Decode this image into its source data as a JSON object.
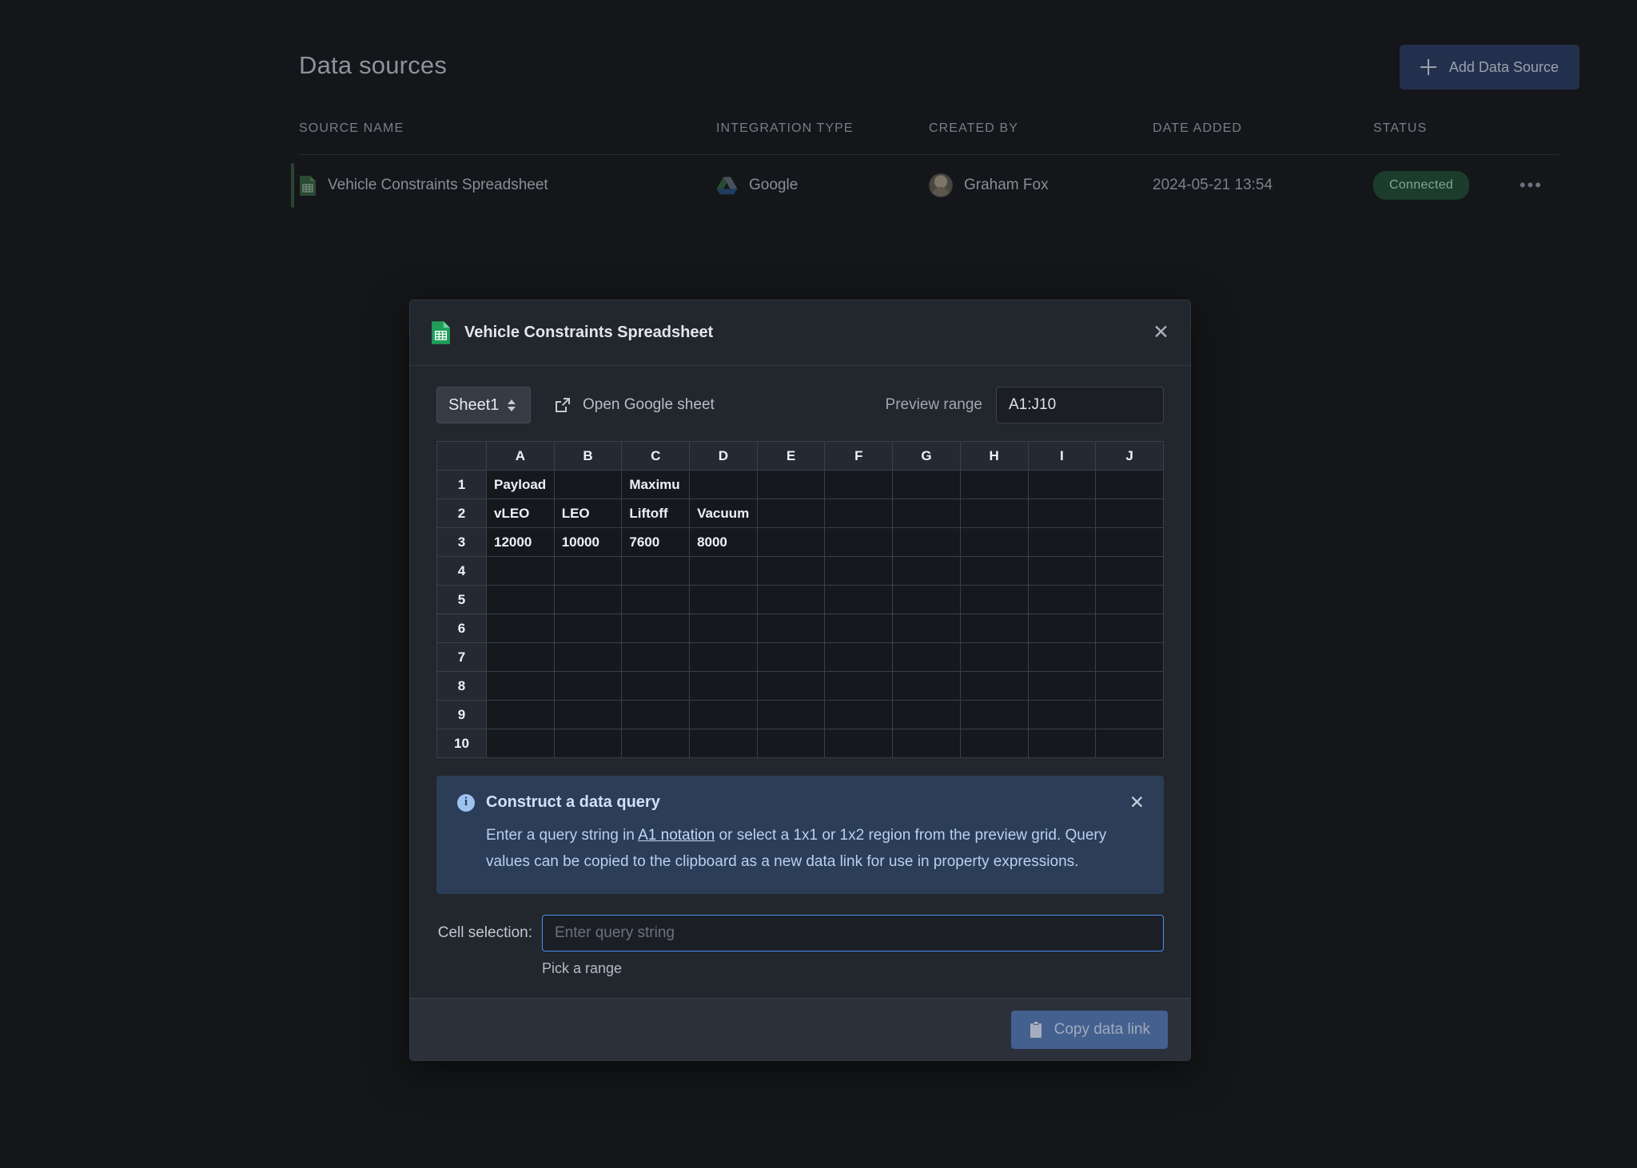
{
  "page": {
    "title": "Data sources",
    "add_button": {
      "label": "Add Data Source",
      "icon": "plus-icon"
    }
  },
  "table": {
    "columns": [
      "SOURCE NAME",
      "INTEGRATION TYPE",
      "CREATED BY",
      "DATE ADDED",
      "STATUS"
    ],
    "rows": [
      {
        "name": "Vehicle Constraints Spreadsheet",
        "name_icon": "google-sheets-file-icon",
        "integration_type": "Google",
        "integration_icon": "google-drive-icon",
        "created_by": "Graham Fox",
        "created_by_avatar": "user-avatar",
        "date_added": "2024-05-21 13:54",
        "status": "Connected",
        "status_color": "#1c3d2b",
        "overflow_menu": "•••"
      }
    ]
  },
  "modal": {
    "title": "Vehicle Constraints Spreadsheet",
    "title_icon": "google-sheets-file-icon",
    "close_label": "✕",
    "toolbar": {
      "sheet_select_value": "Sheet1",
      "open_sheet_label": "Open Google sheet",
      "open_sheet_icon": "external-link-icon",
      "preview_range_label": "Preview range",
      "preview_range_value": "A1:J10"
    },
    "grid": {
      "column_headers": [
        "A",
        "B",
        "C",
        "D",
        "E",
        "F",
        "G",
        "H",
        "I",
        "J"
      ],
      "row_numbers": [
        "1",
        "2",
        "3",
        "4",
        "5",
        "6",
        "7",
        "8",
        "9",
        "10"
      ],
      "cells": [
        [
          "Payload",
          "",
          "Maximu",
          "",
          "",
          "",
          "",
          "",
          "",
          ""
        ],
        [
          "vLEO",
          "LEO",
          "Liftoff",
          "Vacuum",
          "",
          "",
          "",
          "",
          "",
          ""
        ],
        [
          "12000",
          "10000",
          "7600",
          "8000",
          "",
          "",
          "",
          "",
          "",
          ""
        ],
        [
          "",
          "",
          "",
          "",
          "",
          "",
          "",
          "",
          "",
          ""
        ],
        [
          "",
          "",
          "",
          "",
          "",
          "",
          "",
          "",
          "",
          ""
        ],
        [
          "",
          "",
          "",
          "",
          "",
          "",
          "",
          "",
          "",
          ""
        ],
        [
          "",
          "",
          "",
          "",
          "",
          "",
          "",
          "",
          "",
          ""
        ],
        [
          "",
          "",
          "",
          "",
          "",
          "",
          "",
          "",
          "",
          ""
        ],
        [
          "",
          "",
          "",
          "",
          "",
          "",
          "",
          "",
          "",
          ""
        ],
        [
          "",
          "",
          "",
          "",
          "",
          "",
          "",
          "",
          "",
          ""
        ]
      ]
    },
    "info": {
      "icon": "info-icon",
      "title": "Construct a data query",
      "body_part1": "Enter a query string in ",
      "link_text": "A1 notation",
      "body_part2": " or select a 1x1 or 1x2 region from the preview grid. Query values can be copied to the clipboard as a new data link for use in property expressions.",
      "close_label": "✕",
      "background_color": "#2b3d57"
    },
    "cell_selection": {
      "label": "Cell selection:",
      "value": "",
      "placeholder": "Enter query string",
      "hint": "Pick a range",
      "focus_color": "#4c8ff0"
    },
    "footer": {
      "copy_label": "Copy data link",
      "copy_icon": "clipboard-icon"
    }
  }
}
